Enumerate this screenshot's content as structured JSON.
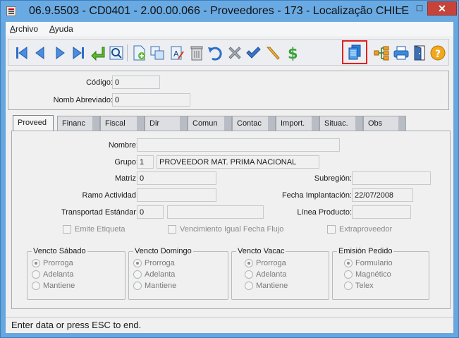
{
  "window": {
    "title": "06.9.5503 - CD0401 - 2.00.00.066 - Proveedores - 173 - Localização CHILE",
    "minimize": "–",
    "maximize": "□",
    "close": "✕"
  },
  "menu": {
    "items": [
      {
        "label": "Archivo"
      },
      {
        "label": "Ayuda"
      }
    ]
  },
  "toolbar": {
    "buttons": [
      {
        "icon": "first-record-icon"
      },
      {
        "icon": "previous-record-icon"
      },
      {
        "icon": "next-record-icon"
      },
      {
        "icon": "last-record-icon"
      },
      {
        "icon": "return-icon"
      },
      {
        "icon": "search-icon"
      },
      {
        "icon": "new-record-icon"
      },
      {
        "icon": "copy-icon"
      },
      {
        "icon": "edit-icon"
      },
      {
        "icon": "delete-icon"
      },
      {
        "icon": "undo-icon"
      },
      {
        "icon": "cancel-icon"
      },
      {
        "icon": "confirm-icon"
      },
      {
        "icon": "pencil-icon"
      },
      {
        "icon": "dollar-icon"
      },
      {
        "icon": "documents-icon",
        "highlighted": true
      },
      {
        "icon": "hierarchy-icon"
      },
      {
        "icon": "print-icon"
      },
      {
        "icon": "exit-door-icon"
      },
      {
        "icon": "help-icon"
      }
    ]
  },
  "header": {
    "codigo_label": "Código:",
    "codigo_value": "0",
    "nomb_label": "Nomb Abreviado:",
    "nomb_value": "0"
  },
  "tabs": [
    {
      "label": "Proveed",
      "active": true
    },
    {
      "label": "Financ"
    },
    {
      "label": "Fiscal"
    },
    {
      "label": "Dir"
    },
    {
      "label": "Comun"
    },
    {
      "label": "Contac"
    },
    {
      "label": "Import."
    },
    {
      "label": "Situac."
    },
    {
      "label": "Obs"
    }
  ],
  "form": {
    "nombre_label": "Nombre:",
    "nombre_value": "",
    "grupo_label": "Grupo:",
    "grupo_code": "1",
    "grupo_desc": "PROVEEDOR MAT. PRIMA NACIONAL",
    "matriz_label": "Matriz:",
    "matriz_value": "0",
    "subregion_label": "Subregión:",
    "subregion_value": "",
    "ramo_label": "Ramo Actividad:",
    "ramo_value": "",
    "fecha_label": "Fecha Implantación:",
    "fecha_value": "22/07/2008",
    "transp_label": "Transportad Estándar:",
    "transp_code": "0",
    "transp_desc": "",
    "linea_label": "Línea Producto:",
    "linea_value": "",
    "emite_label": "Emite Etiqueta",
    "venc_label": "Vencimiento Igual Fecha Flujo",
    "extra_label": "Extraproveedor"
  },
  "groups": [
    {
      "title": "Vencto Sábado",
      "options": [
        "Prorroga",
        "Adelanta",
        "Mantiene"
      ],
      "selected": 0
    },
    {
      "title": "Vencto Domingo",
      "options": [
        "Prorroga",
        "Adelanta",
        "Mantiene"
      ],
      "selected": 0
    },
    {
      "title": "Vencto Vacac",
      "options": [
        "Prorroga",
        "Adelanta",
        "Mantiene"
      ],
      "selected": 0
    },
    {
      "title": "Emisión Pedido",
      "options": [
        "Formulario",
        "Magnético",
        "Telex"
      ],
      "selected": 0
    }
  ],
  "status": {
    "text": "Enter data or press ESC to end."
  }
}
